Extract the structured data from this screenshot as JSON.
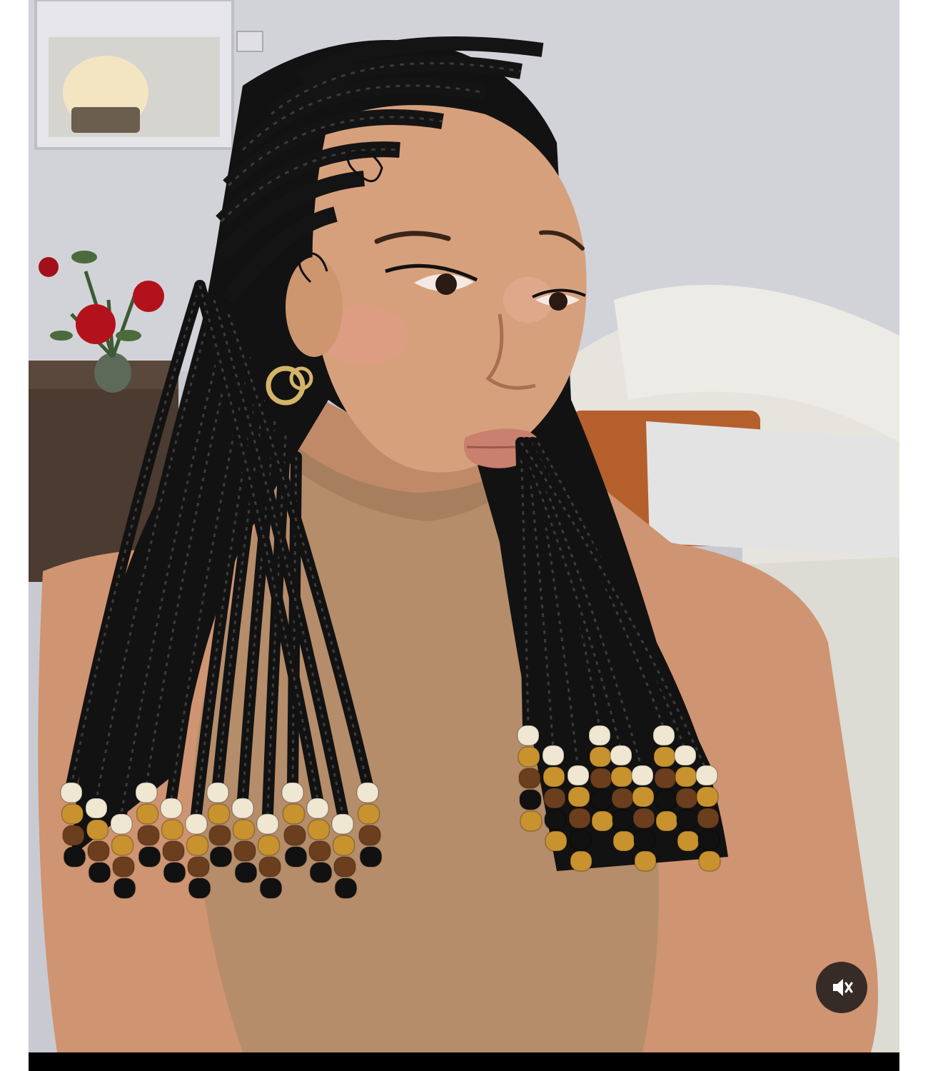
{
  "photo": {
    "subject": "woman-with-beaded-braids",
    "colors": {
      "wall": "#cfd0d6",
      "hair": "#121212",
      "skin": "#d7a07c",
      "turtleneck": "#b58d6a",
      "sofa": "#e8e6df",
      "pillow_orange": "#b5602c",
      "bead_cream": "#efe7d2",
      "bead_amber": "#c8922e",
      "bead_brown": "#6b3e1e",
      "bead_black": "#111111",
      "flowers": "#b3121c",
      "side_table": "#4a3a30"
    }
  },
  "controls": {
    "mute_button": {
      "icon": "speaker-muted-icon",
      "state": "muted"
    }
  }
}
